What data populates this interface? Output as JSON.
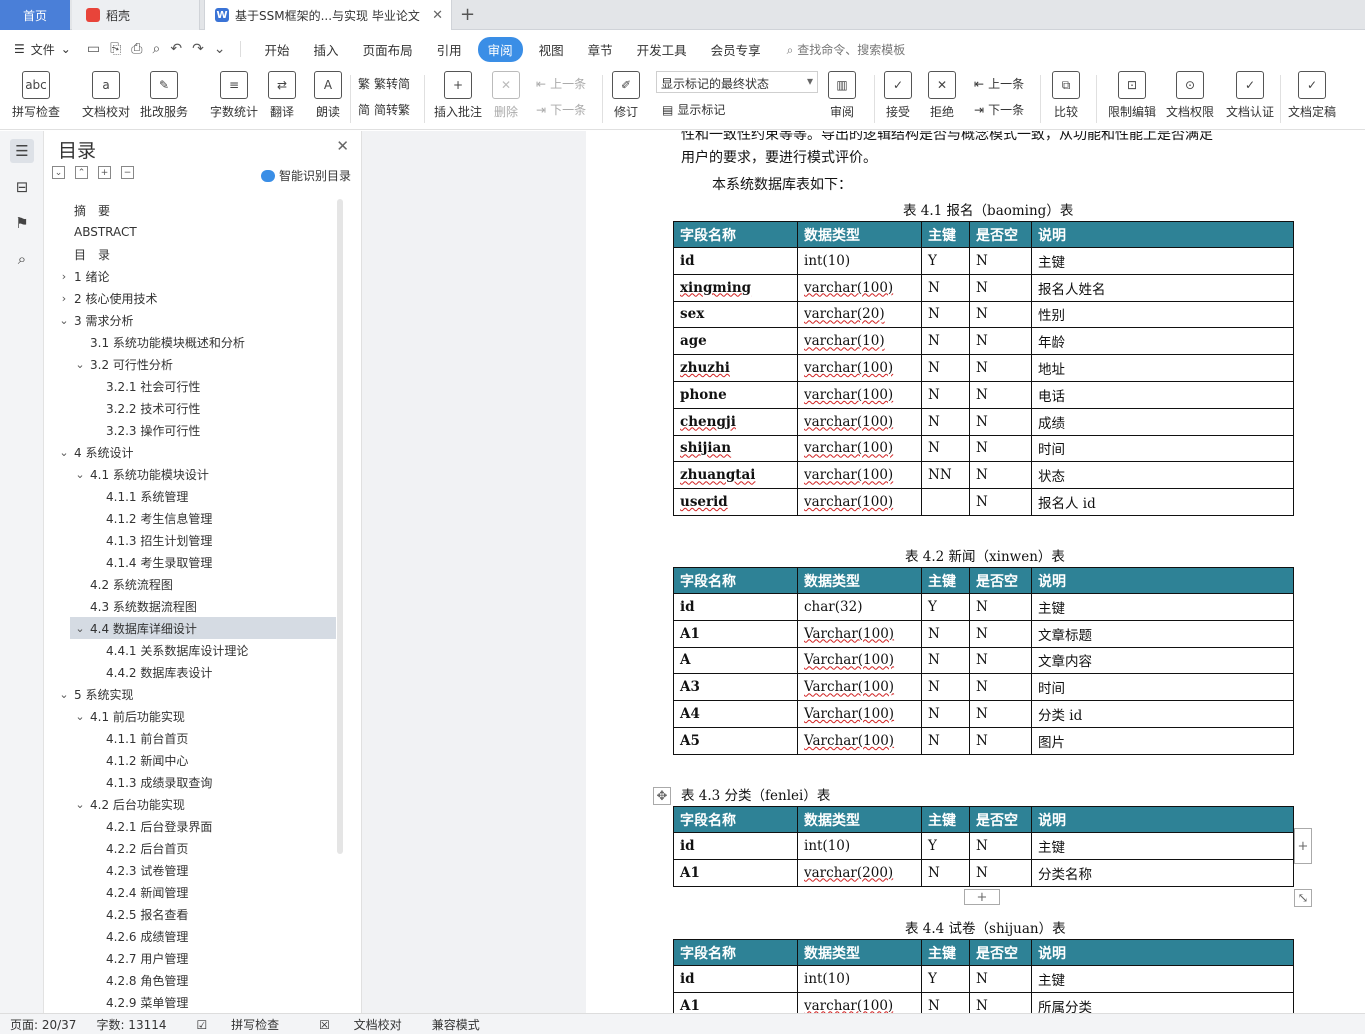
{
  "tabs": {
    "home": "首页",
    "daoke": "稻壳",
    "doc": "基于SSM框架的...与实现 毕业论文",
    "close": "✕",
    "add": "+"
  },
  "menubar": {
    "file": "文件",
    "items": [
      "开始",
      "插入",
      "页面布局",
      "引用",
      "审阅",
      "视图",
      "章节",
      "开发工具",
      "会员专享"
    ],
    "active": "审阅",
    "search": "查找命令、搜索模板"
  },
  "ribbon": {
    "spell": "拼写检查",
    "proof": "文档校对",
    "annotate": "批改服务",
    "wordcount": "字数统计",
    "translate": "翻译",
    "read": "朗读",
    "s2t": "繁转简",
    "t2s": "简转繁",
    "insert_comment": "插入批注",
    "delete": "删除",
    "prev": "上一条",
    "next": "下一条",
    "revise": "修订",
    "markup_state": "显示标记的最终状态",
    "show_markup": "显示标记",
    "review": "审阅",
    "accept": "接受",
    "reject": "拒绝",
    "prev2": "上一条",
    "next2": "下一条",
    "compare": "比较",
    "restrict": "限制编辑",
    "permission": "文档权限",
    "certify": "文档认证",
    "finalize": "文档定稿"
  },
  "toc": {
    "title": "目录",
    "smart": "智能识别目录",
    "items": [
      {
        "label": "摘　要",
        "level": 0,
        "chev": ""
      },
      {
        "label": "ABSTRACT",
        "level": 0,
        "chev": ""
      },
      {
        "label": "目　录",
        "level": 0,
        "chev": ""
      },
      {
        "label": "1  绪论",
        "level": 0,
        "chev": "›"
      },
      {
        "label": "2  核心使用技术",
        "level": 0,
        "chev": "›"
      },
      {
        "label": "3  需求分析",
        "level": 0,
        "chev": "⌄"
      },
      {
        "label": "3.1  系统功能模块概述和分析",
        "level": 1,
        "chev": ""
      },
      {
        "label": "3.2  可行性分析",
        "level": 1,
        "chev": "⌄"
      },
      {
        "label": "3.2.1  社会可行性",
        "level": 2,
        "chev": ""
      },
      {
        "label": "3.2.2  技术可行性",
        "level": 2,
        "chev": ""
      },
      {
        "label": "3.2.3  操作可行性",
        "level": 2,
        "chev": ""
      },
      {
        "label": "4  系统设计",
        "level": 0,
        "chev": "⌄"
      },
      {
        "label": "4.1  系统功能模块设计",
        "level": 1,
        "chev": "⌄"
      },
      {
        "label": "4.1.1  系统管理",
        "level": 2,
        "chev": ""
      },
      {
        "label": "4.1.2  考生信息管理",
        "level": 2,
        "chev": ""
      },
      {
        "label": "4.1.3  招生计划管理",
        "level": 2,
        "chev": ""
      },
      {
        "label": "4.1.4  考生录取管理",
        "level": 2,
        "chev": ""
      },
      {
        "label": "4.2  系统流程图",
        "level": 1,
        "chev": ""
      },
      {
        "label": "4.3  系统数据流程图",
        "level": 1,
        "chev": ""
      },
      {
        "label": "4.4  数据库详细设计",
        "level": 1,
        "chev": "⌄",
        "selected": true
      },
      {
        "label": "4.4.1  关系数据库设计理论",
        "level": 2,
        "chev": ""
      },
      {
        "label": "4.4.2  数据库表设计",
        "level": 2,
        "chev": ""
      },
      {
        "label": "5  系统实现",
        "level": 0,
        "chev": "⌄"
      },
      {
        "label": "4.1  前后功能实现",
        "level": 1,
        "chev": "⌄"
      },
      {
        "label": "4.1.1  前台首页",
        "level": 2,
        "chev": ""
      },
      {
        "label": "4.1.2  新闻中心",
        "level": 2,
        "chev": ""
      },
      {
        "label": "4.1.3  成绩录取查询",
        "level": 2,
        "chev": ""
      },
      {
        "label": "4.2  后台功能实现",
        "level": 1,
        "chev": "⌄"
      },
      {
        "label": "4.2.1  后台登录界面",
        "level": 2,
        "chev": ""
      },
      {
        "label": "4.2.2  后台首页",
        "level": 2,
        "chev": ""
      },
      {
        "label": "4.2.3  试卷管理",
        "level": 2,
        "chev": ""
      },
      {
        "label": "4.2.4  新闻管理",
        "level": 2,
        "chev": ""
      },
      {
        "label": "4.2.5  报名查看",
        "level": 2,
        "chev": ""
      },
      {
        "label": "4.2.6  成绩管理",
        "level": 2,
        "chev": ""
      },
      {
        "label": "4.2.7  用户管理",
        "level": 2,
        "chev": ""
      },
      {
        "label": "4.2.8  角色管理",
        "level": 2,
        "chev": ""
      },
      {
        "label": "4.2.9  菜单管理",
        "level": 2,
        "chev": ""
      }
    ]
  },
  "doc": {
    "line1": "性和一致性约束等等。导出的逻辑结构是否与概念模式一致，从功能和性能上是否满足",
    "line2": "用户的要求，要进行模式评价。",
    "line3": "本系统数据库表如下：",
    "headers": [
      "字段名称",
      "数据类型",
      "主键",
      "是否空",
      "说明"
    ],
    "tables": [
      {
        "caption": "表 4.1 报名（baoming）表",
        "rows": [
          [
            "id",
            "int(10)",
            "Y",
            "N",
            "主键"
          ],
          [
            "xingming",
            "varchar(100)",
            "N",
            "N",
            "报名人姓名"
          ],
          [
            "sex",
            "varchar(20)",
            "N",
            "N",
            "性别"
          ],
          [
            "age",
            "varchar(10)",
            "N",
            "N",
            "年龄"
          ],
          [
            "zhuzhi",
            "varchar(100)",
            "N",
            "N",
            "地址"
          ],
          [
            "phone",
            "varchar(100)",
            "N",
            "N",
            "电话"
          ],
          [
            "chengji",
            "varchar(100)",
            "N",
            "N",
            "成绩"
          ],
          [
            "shijian",
            "varchar(100)",
            "N",
            "N",
            "时间"
          ],
          [
            "zhuangtai",
            "varchar(100)",
            "NN",
            "N",
            "状态"
          ],
          [
            "userid",
            "varchar(100)",
            "",
            "N",
            "报名人 id"
          ]
        ]
      },
      {
        "caption": "表 4.2 新闻（xinwen）表",
        "rows": [
          [
            "id",
            "char(32)",
            "Y",
            "N",
            "主键"
          ],
          [
            "A1",
            "Varchar(100)",
            "N",
            "N",
            "文章标题"
          ],
          [
            "A",
            "Varchar(100)",
            "N",
            "N",
            "文章内容"
          ],
          [
            "A3",
            "Varchar(100)",
            "N",
            "N",
            "时间"
          ],
          [
            "A4",
            "Varchar(100)",
            "N",
            "N",
            "分类 id"
          ],
          [
            "A5",
            "Varchar(100)",
            "N",
            "N",
            "图片"
          ]
        ]
      },
      {
        "caption": "表 4.3  分类（fenlei）表",
        "rows": [
          [
            "id",
            "int(10)",
            "Y",
            "N",
            "主键"
          ],
          [
            "A1",
            "varchar(200)",
            "N",
            "N",
            "分类名称"
          ]
        ]
      },
      {
        "caption": "表 4.4  试卷（shijuan）表",
        "rows": [
          [
            "id",
            "int(10)",
            "Y",
            "N",
            "主键"
          ],
          [
            "A1",
            "varchar(100)",
            "N",
            "N",
            "所属分类"
          ]
        ]
      }
    ]
  },
  "status": {
    "page": "页面: 20/37",
    "words": "字数: 13114",
    "spell": "拼写检查",
    "proof": "文档校对",
    "compat": "兼容模式"
  }
}
